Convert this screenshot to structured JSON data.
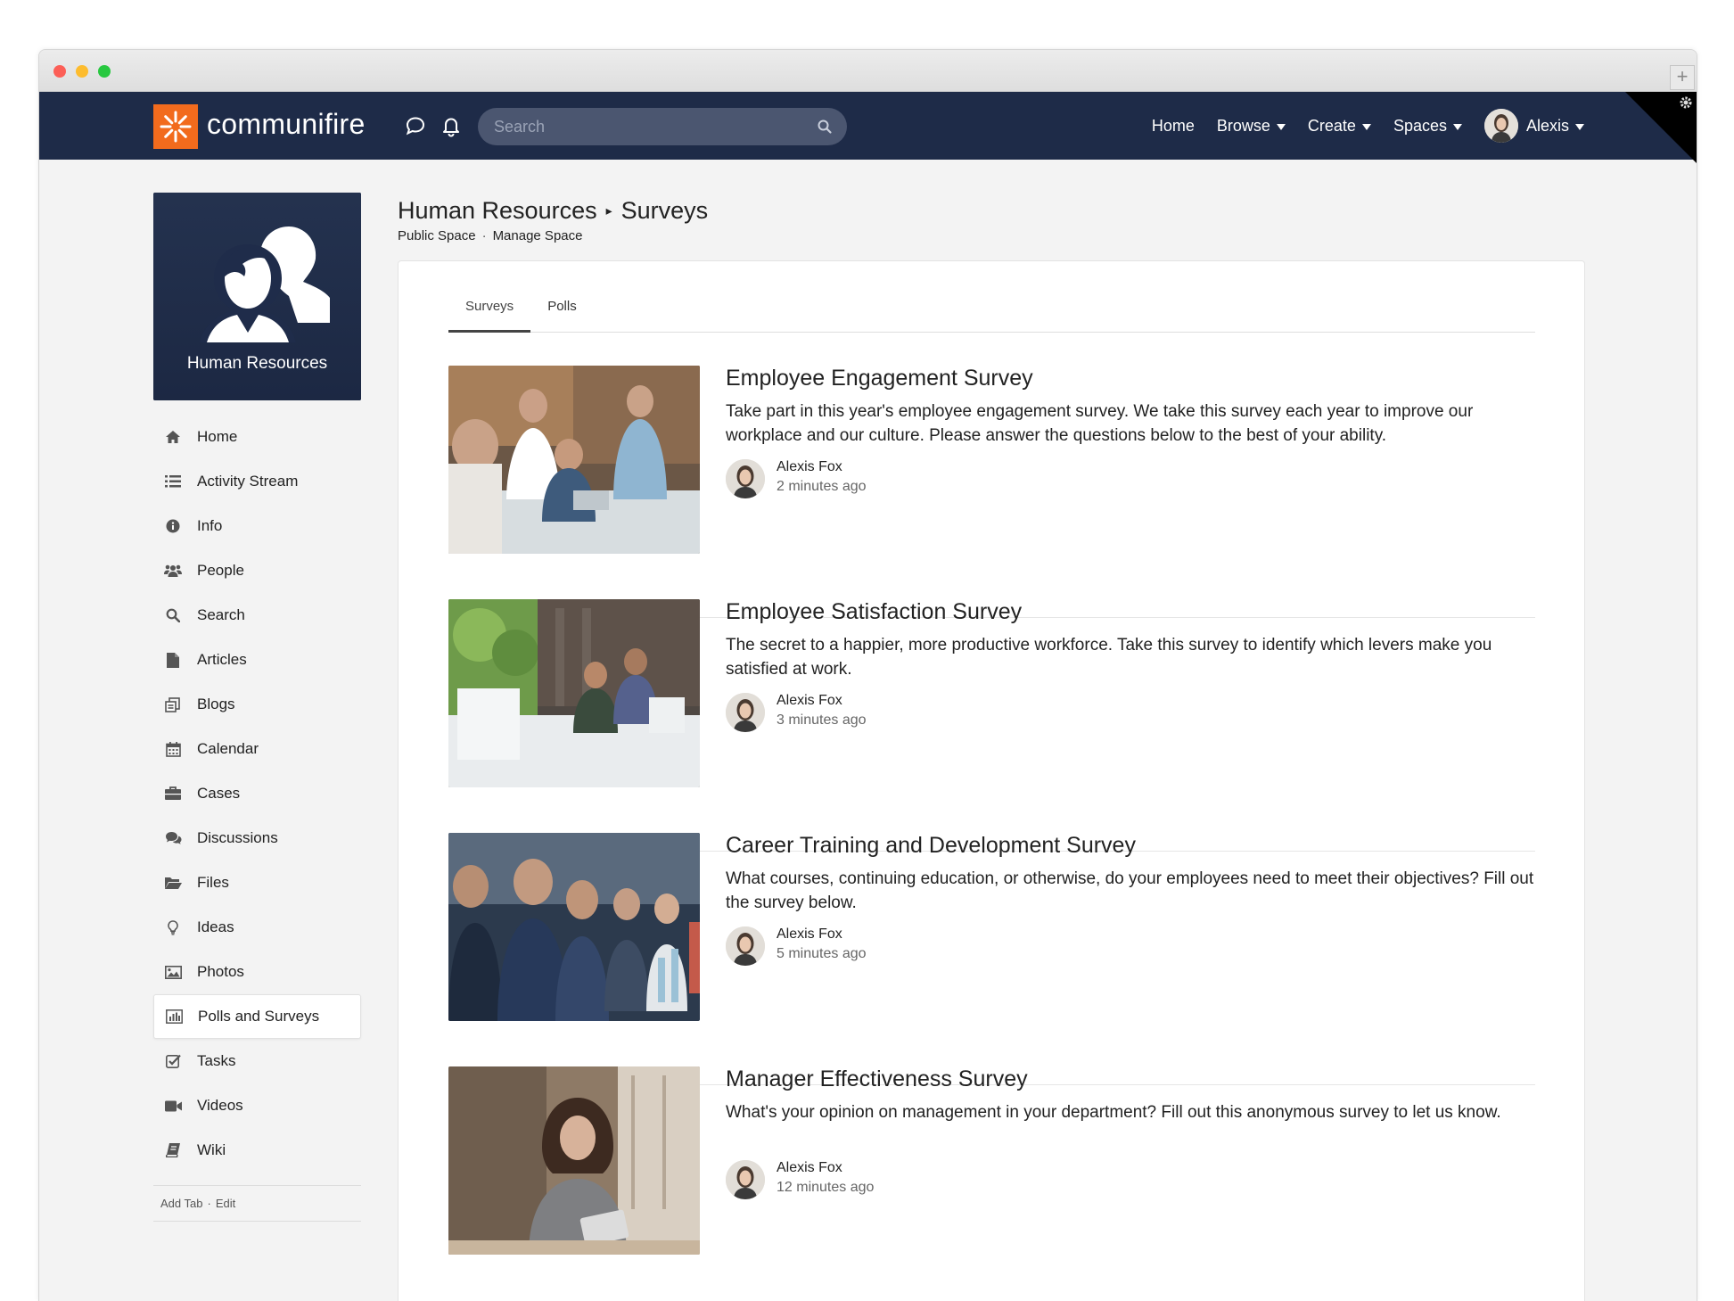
{
  "brand": {
    "name": "communifire",
    "accent": "#f26b1d",
    "nav_bg": "#1e2b48"
  },
  "navbar": {
    "search_placeholder": "Search",
    "links": [
      {
        "label": "Home",
        "dropdown": false
      },
      {
        "label": "Browse",
        "dropdown": true
      },
      {
        "label": "Create",
        "dropdown": true
      },
      {
        "label": "Spaces",
        "dropdown": true
      }
    ],
    "user": {
      "name": "Alexis"
    }
  },
  "space": {
    "name": "Human Resources",
    "breadcrumb_current": "Surveys",
    "sub_links": [
      "Public Space",
      "Manage Space"
    ]
  },
  "sidebar": {
    "items": [
      {
        "label": "Home",
        "icon": "home-icon"
      },
      {
        "label": "Activity Stream",
        "icon": "list-icon"
      },
      {
        "label": "Info",
        "icon": "info-icon"
      },
      {
        "label": "People",
        "icon": "people-icon"
      },
      {
        "label": "Search",
        "icon": "search-icon"
      },
      {
        "label": "Articles",
        "icon": "document-icon"
      },
      {
        "label": "Blogs",
        "icon": "blog-icon"
      },
      {
        "label": "Calendar",
        "icon": "calendar-icon"
      },
      {
        "label": "Cases",
        "icon": "briefcase-icon"
      },
      {
        "label": "Discussions",
        "icon": "chat-icon"
      },
      {
        "label": "Files",
        "icon": "folder-icon"
      },
      {
        "label": "Ideas",
        "icon": "lightbulb-icon"
      },
      {
        "label": "Photos",
        "icon": "image-icon"
      },
      {
        "label": "Polls and Surveys",
        "icon": "bar-chart-icon",
        "active": true
      },
      {
        "label": "Tasks",
        "icon": "checkbox-icon"
      },
      {
        "label": "Videos",
        "icon": "video-icon"
      },
      {
        "label": "Wiki",
        "icon": "book-icon"
      }
    ],
    "footer": {
      "add_tab": "Add Tab",
      "separator": "·",
      "edit": "Edit"
    }
  },
  "tabs": [
    {
      "label": "Surveys",
      "active": true
    },
    {
      "label": "Polls",
      "active": false
    }
  ],
  "surveys": [
    {
      "title": "Employee Engagement Survey",
      "description": "Take part in this year's employee engagement survey. We take this survey each year to improve our workplace and our culture. Please answer the questions below to the best of your ability.",
      "author": "Alexis Fox",
      "time": "2 minutes ago"
    },
    {
      "title": "Employee Satisfaction Survey",
      "description": "The secret to a happier, more productive workforce. Take this survey to identify which levers make you satisfied at work.",
      "author": "Alexis Fox",
      "time": "3 minutes ago"
    },
    {
      "title": "Career Training and Development Survey",
      "description": "What courses, continuing education, or otherwise, do your employees need to meet their objectives? Fill out the survey below.",
      "author": "Alexis Fox",
      "time": "5 minutes ago"
    },
    {
      "title": "Manager Effectiveness Survey",
      "description": "What's your opinion on management in your department? Fill out this anonymous survey to let us know.",
      "author": "Alexis Fox",
      "time": "12 minutes ago"
    }
  ]
}
